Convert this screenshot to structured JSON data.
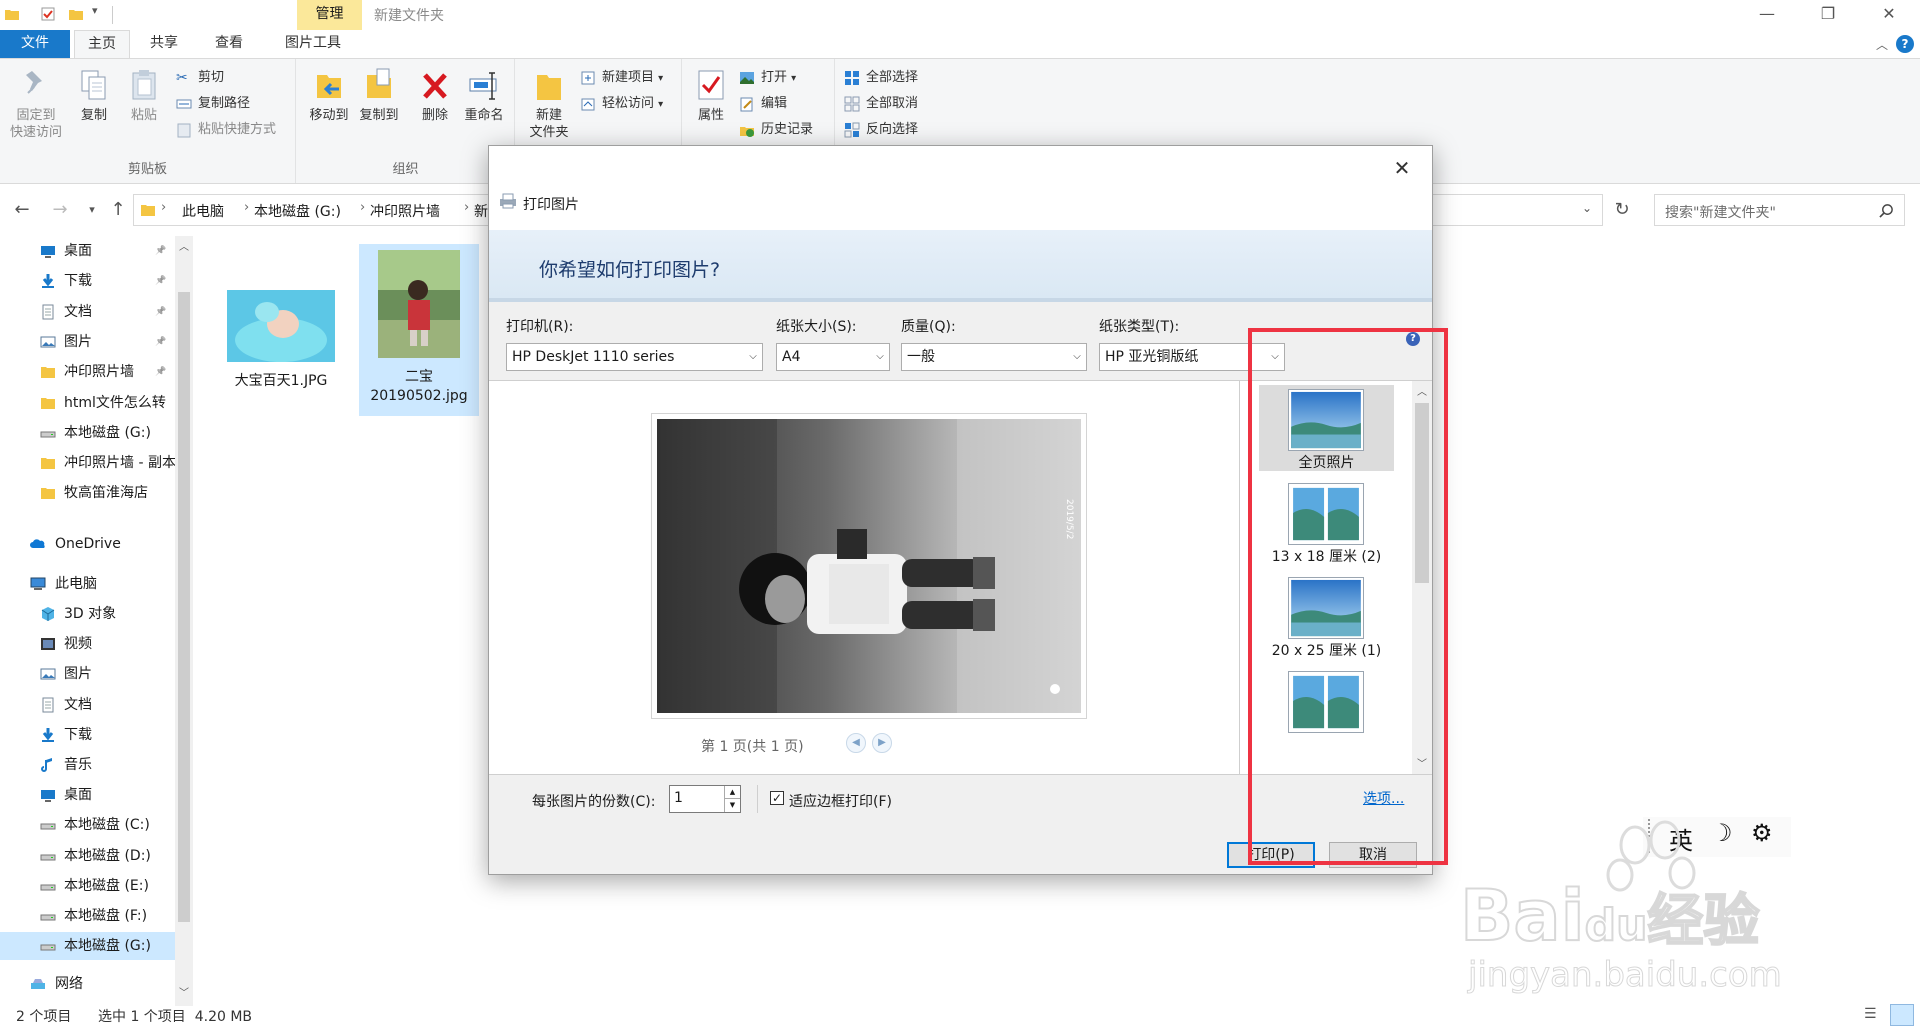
{
  "window": {
    "context_tab_header": "管理",
    "title": "新建文件夹",
    "minimize": "—",
    "maximize": "❐",
    "close": "✕"
  },
  "ribbon_tabs": {
    "file": "文件",
    "home": "主页",
    "share": "共享",
    "view": "查看",
    "picture_tools": "图片工具",
    "help": "?"
  },
  "ribbon": {
    "clipboard": {
      "label": "剪贴板",
      "pin_line1": "固定到",
      "pin_line2": "快速访问",
      "copy": "复制",
      "paste": "粘贴",
      "cut": "剪切",
      "copy_path": "复制路径",
      "paste_shortcut": "粘贴快捷方式"
    },
    "organize": {
      "label": "组织",
      "move_to": "移动到",
      "copy_to": "复制到",
      "delete": "删除",
      "rename": "重命名"
    },
    "new": {
      "new_folder_line1": "新建",
      "new_folder_line2": "文件夹",
      "new_item": "新建项目",
      "easy_access": "轻松访问"
    },
    "open": {
      "properties": "属性",
      "open": "打开",
      "edit": "编辑",
      "history": "历史记录"
    },
    "select": {
      "select_all": "全部选择",
      "select_none": "全部取消",
      "invert": "反向选择"
    }
  },
  "address": {
    "crumbs": [
      "此电脑",
      "本地磁盘 (G:)",
      "冲印照片墙",
      "新"
    ],
    "search_placeholder": "搜索\"新建文件夹\""
  },
  "nav": {
    "quick_access": [
      {
        "label": "桌面",
        "icon": "desktop-icon"
      },
      {
        "label": "下载",
        "icon": "download-icon"
      },
      {
        "label": "文档",
        "icon": "document-icon"
      },
      {
        "label": "图片",
        "icon": "picture-icon"
      },
      {
        "label": "冲印照片墙",
        "icon": "folder-icon"
      },
      {
        "label": "html文件怎么转",
        "icon": "folder-icon"
      },
      {
        "label": "本地磁盘 (G:)",
        "icon": "drive-icon"
      },
      {
        "label": "冲印照片墙 - 副本",
        "icon": "folder-icon"
      },
      {
        "label": "牧高笛淮海店",
        "icon": "folder-icon"
      }
    ],
    "onedrive": "OneDrive",
    "this_pc": "此电脑",
    "pc_items": [
      {
        "label": "3D 对象",
        "icon": "3d-objects-icon"
      },
      {
        "label": "视频",
        "icon": "video-icon"
      },
      {
        "label": "图片",
        "icon": "picture-icon"
      },
      {
        "label": "文档",
        "icon": "document-icon"
      },
      {
        "label": "下载",
        "icon": "download-icon"
      },
      {
        "label": "音乐",
        "icon": "music-icon"
      },
      {
        "label": "桌面",
        "icon": "desktop-icon"
      },
      {
        "label": "本地磁盘 (C:)",
        "icon": "drive-icon"
      },
      {
        "label": "本地磁盘 (D:)",
        "icon": "drive-icon"
      },
      {
        "label": "本地磁盘 (E:)",
        "icon": "drive-icon"
      },
      {
        "label": "本地磁盘 (F:)",
        "icon": "drive-icon"
      },
      {
        "label": "本地磁盘 (G:)",
        "icon": "drive-icon"
      }
    ],
    "network": "网络"
  },
  "files": [
    {
      "name": "大宝百天1.JPG"
    },
    {
      "name": "二宝\n20190502.jpg",
      "name_line1": "二宝",
      "name_line2": "20190502.jpg"
    }
  ],
  "status": {
    "count": "2 个项目",
    "selection": "选中 1 个项目  4.20 MB"
  },
  "dialog": {
    "title": "打印图片",
    "close": "✕",
    "question": "你希望如何打印图片?",
    "printer_label": "打印机(R):",
    "printer_value": "HP DeskJet 1110 series",
    "paper_size_label": "纸张大小(S):",
    "paper_size_value": "A4",
    "quality_label": "质量(Q):",
    "quality_value": "一般",
    "paper_type_label": "纸张类型(T):",
    "paper_type_value": "HP 亚光铜版纸",
    "page_info": "第 1 页(共 1 页)",
    "layouts": [
      {
        "label": "全页照片",
        "selected": true
      },
      {
        "label": "13 x 18 厘米 (2)",
        "selected": false
      },
      {
        "label": "20 x 25 厘米 (1)",
        "selected": false
      }
    ],
    "copies_label": "每张图片的份数(C):",
    "copies_value": "1",
    "fit_label": "适应边框打印(F)",
    "fit_checked": true,
    "options_link": "选项...",
    "print_button": "打印(P)",
    "cancel_button": "取消",
    "photo_stamp": "2019/5/2"
  },
  "ime": {
    "lang": "英",
    "moon": "☽",
    "gear": "⚙"
  },
  "watermark": {
    "brand": "Bai",
    "brand_du": "du",
    "brand_suffix": "经验",
    "url": "jingyan.baidu.com"
  },
  "colors": {
    "accent": "#1979ca",
    "highlight": "#ee3342",
    "selection": "#cce8ff",
    "context_tab": "#fbe89a"
  }
}
